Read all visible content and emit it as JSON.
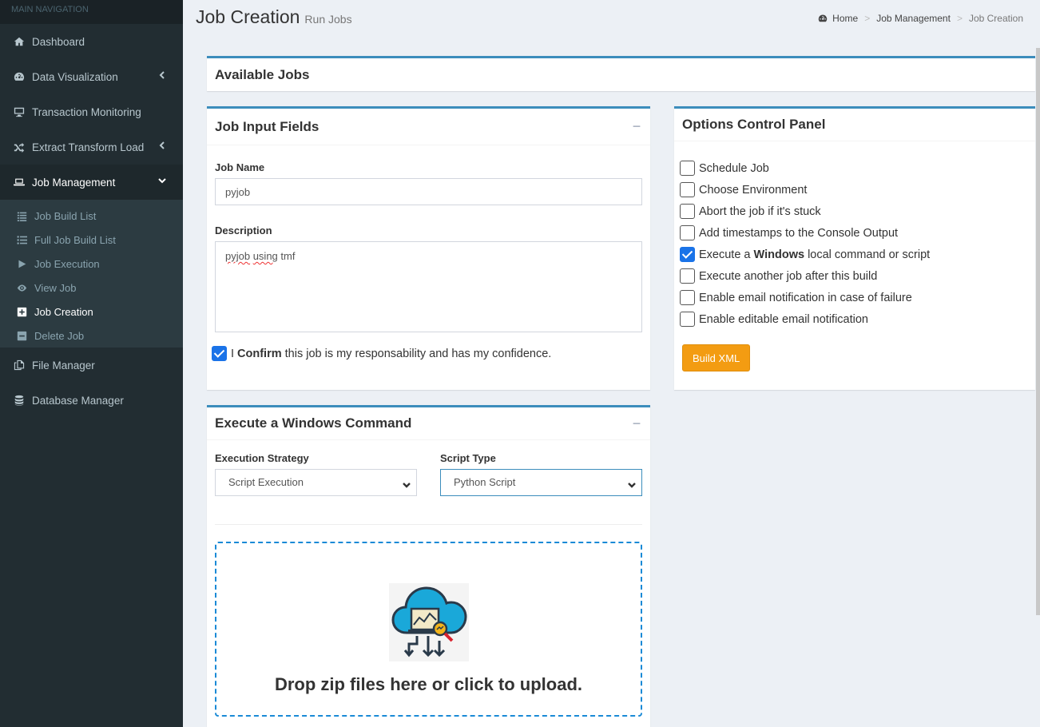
{
  "sidebar": {
    "header": "MAIN NAVIGATION",
    "items": [
      {
        "label": "Dashboard",
        "icon": "home-icon"
      },
      {
        "label": "Data Visualization",
        "icon": "dashboard-icon"
      },
      {
        "label": "Transaction Monitoring",
        "icon": "desktop-icon"
      },
      {
        "label": "Extract Transform Load",
        "icon": "random-icon"
      },
      {
        "label": "Job Management",
        "icon": "laptop-icon"
      },
      {
        "label": "File Manager",
        "icon": "copy-icon"
      },
      {
        "label": "Database Manager",
        "icon": "database-icon"
      }
    ],
    "sub_items": [
      {
        "label": "Job Build List",
        "icon": "list-icon"
      },
      {
        "label": "Full Job Build List",
        "icon": "list-ul-icon"
      },
      {
        "label": "Job Execution",
        "icon": "play-icon"
      },
      {
        "label": "View Job",
        "icon": "eye-icon"
      },
      {
        "label": "Job Creation",
        "icon": "plus-square-icon"
      },
      {
        "label": "Delete Job",
        "icon": "minus-square-icon"
      }
    ]
  },
  "header": {
    "title": "Job Creation",
    "subtitle": "Run Jobs",
    "breadcrumb": [
      "Home",
      "Job Management",
      "Job Creation"
    ]
  },
  "available_jobs": {
    "title": "Available Jobs"
  },
  "job_input": {
    "title": "Job Input Fields",
    "collapse": "−",
    "job_name_label": "Job Name",
    "job_name_value": "pyjob",
    "description_label": "Description",
    "description_value_a": "pyjob",
    "description_value_b": "using",
    "description_value_c": "tmf",
    "confirm_prefix": "I",
    "confirm_bold": "Confirm",
    "confirm_suffix": "this job is my responsability and has my confidence.",
    "confirm_checked": true
  },
  "options": {
    "title": "Options Control Panel",
    "items": [
      {
        "label": "Schedule Job",
        "checked": false
      },
      {
        "label": "Choose Environment",
        "checked": false
      },
      {
        "label": "Abort the job if it's stuck",
        "checked": false
      },
      {
        "label": "Add timestamps to the Console Output",
        "checked": false
      },
      {
        "label_a": "Execute a",
        "label_bold": "Windows",
        "label_b": "local command or script",
        "checked": true
      },
      {
        "label": "Execute another job after this build",
        "checked": false
      },
      {
        "label": "Enable email notification in case of failure",
        "checked": false
      },
      {
        "label": "Enable editable email notification",
        "checked": false
      }
    ],
    "build_button": "Build XML"
  },
  "windows_command": {
    "title": "Execute a Windows Command",
    "collapse": "−",
    "strategy_label": "Execution Strategy",
    "strategy_value": "Script Execution",
    "script_type_label": "Script Type",
    "script_type_value": "Python Script",
    "dropzone_text": "Drop zip files here or click to upload."
  },
  "colors": {
    "sidebar_bg": "#222d32",
    "accent": "#3c8dbc",
    "warning": "#f39c12",
    "checkbox": "#1a73e8",
    "dropzone_border": "#1a8ad6"
  }
}
